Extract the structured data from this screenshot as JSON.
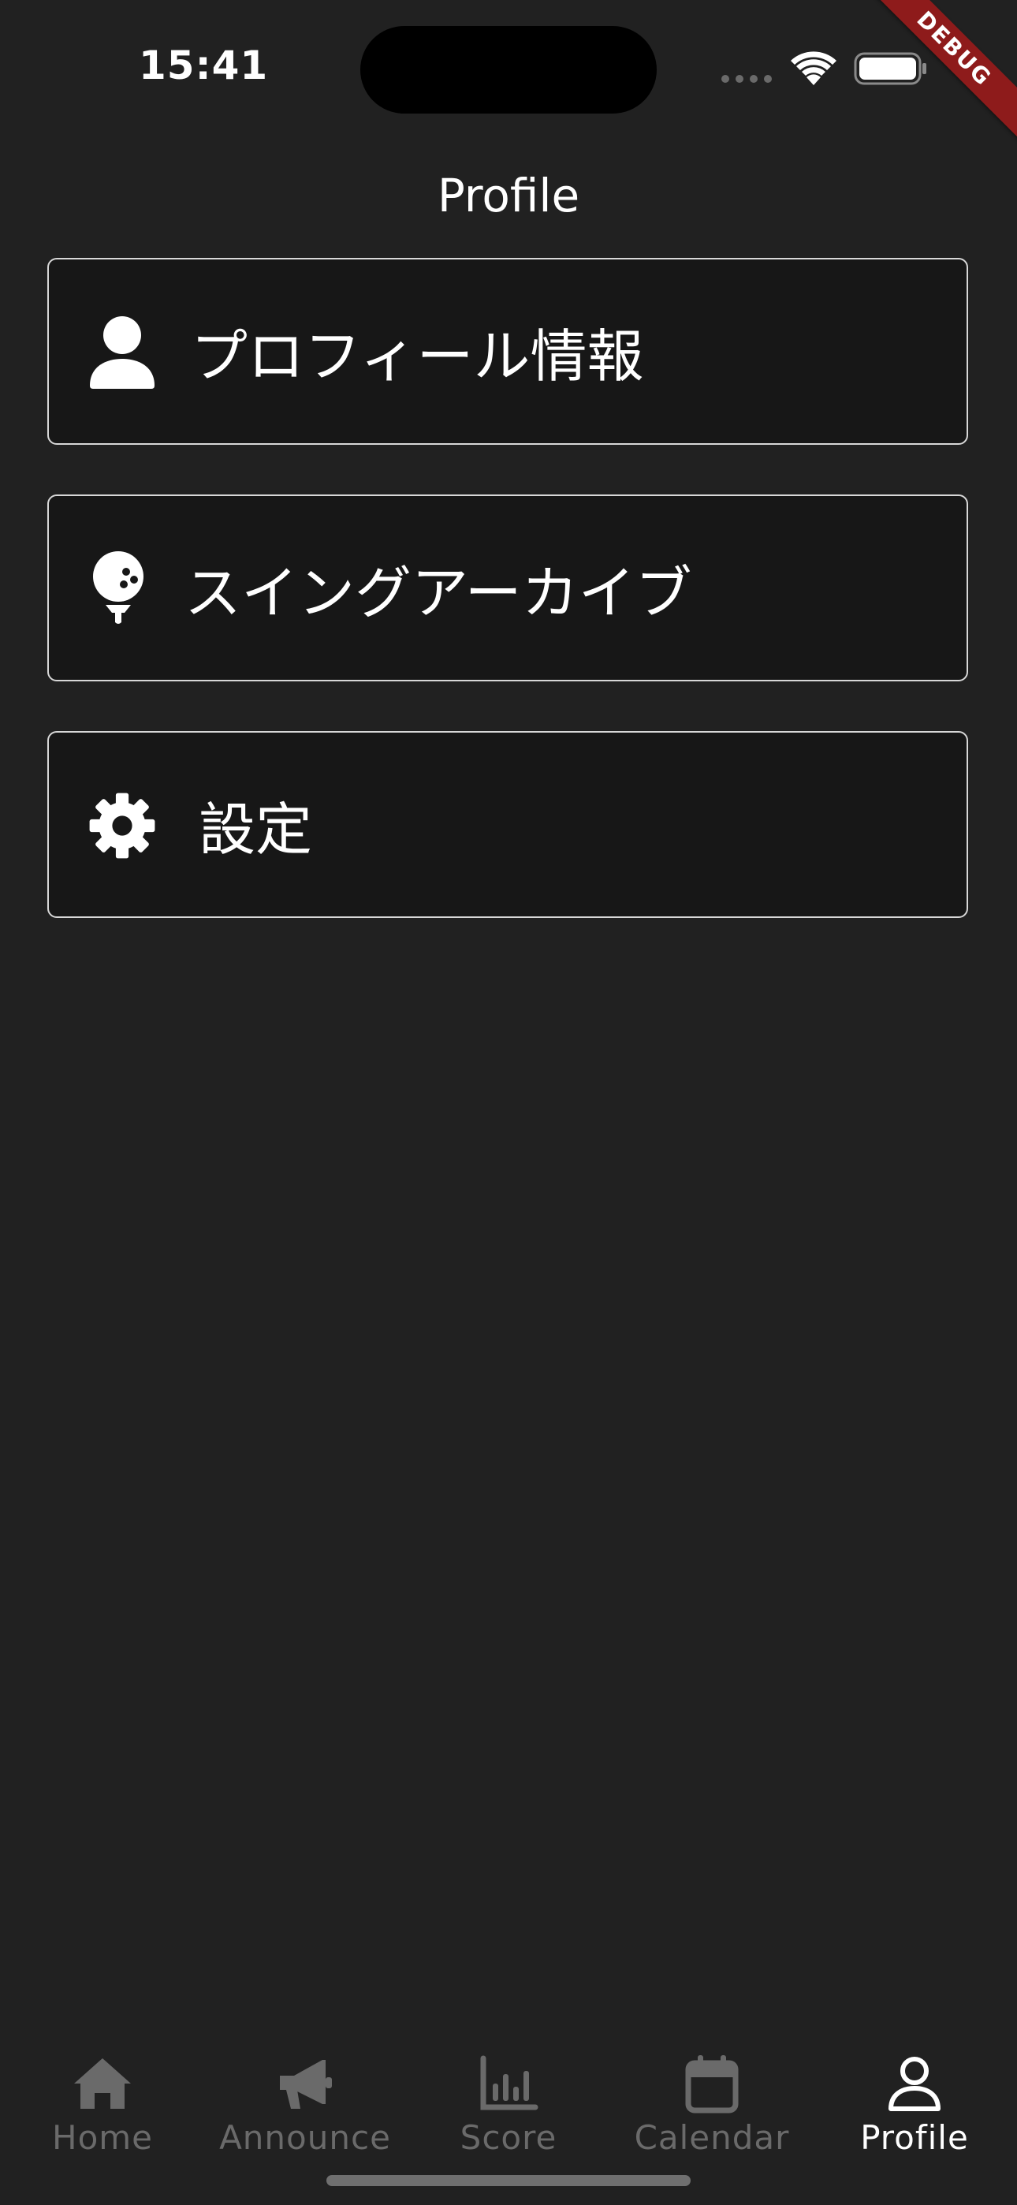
{
  "status_bar": {
    "time": "15:41"
  },
  "debug_banner": "DEBUG",
  "app_bar": {
    "title": "Profile"
  },
  "menu": {
    "items": [
      {
        "label": "プロフィール情報",
        "icon": "person-icon"
      },
      {
        "label": "スイングアーカイブ",
        "icon": "golf-ball-icon"
      },
      {
        "label": "設定",
        "icon": "gear-icon"
      }
    ]
  },
  "bottom_nav": {
    "items": [
      {
        "label": "Home",
        "icon": "home-icon",
        "active": false
      },
      {
        "label": "Announce",
        "icon": "megaphone-icon",
        "active": false
      },
      {
        "label": "Score",
        "icon": "bar-chart-icon",
        "active": false
      },
      {
        "label": "Calendar",
        "icon": "calendar-icon",
        "active": false
      },
      {
        "label": "Profile",
        "icon": "profile-icon",
        "active": true
      }
    ]
  },
  "colors": {
    "background": "#212121",
    "card_background": "#171717",
    "card_border": "#d8d8d8",
    "nav_inactive": "#6a6a6a",
    "nav_active": "#ffffff",
    "debug_ribbon": "#8e1b1b"
  }
}
